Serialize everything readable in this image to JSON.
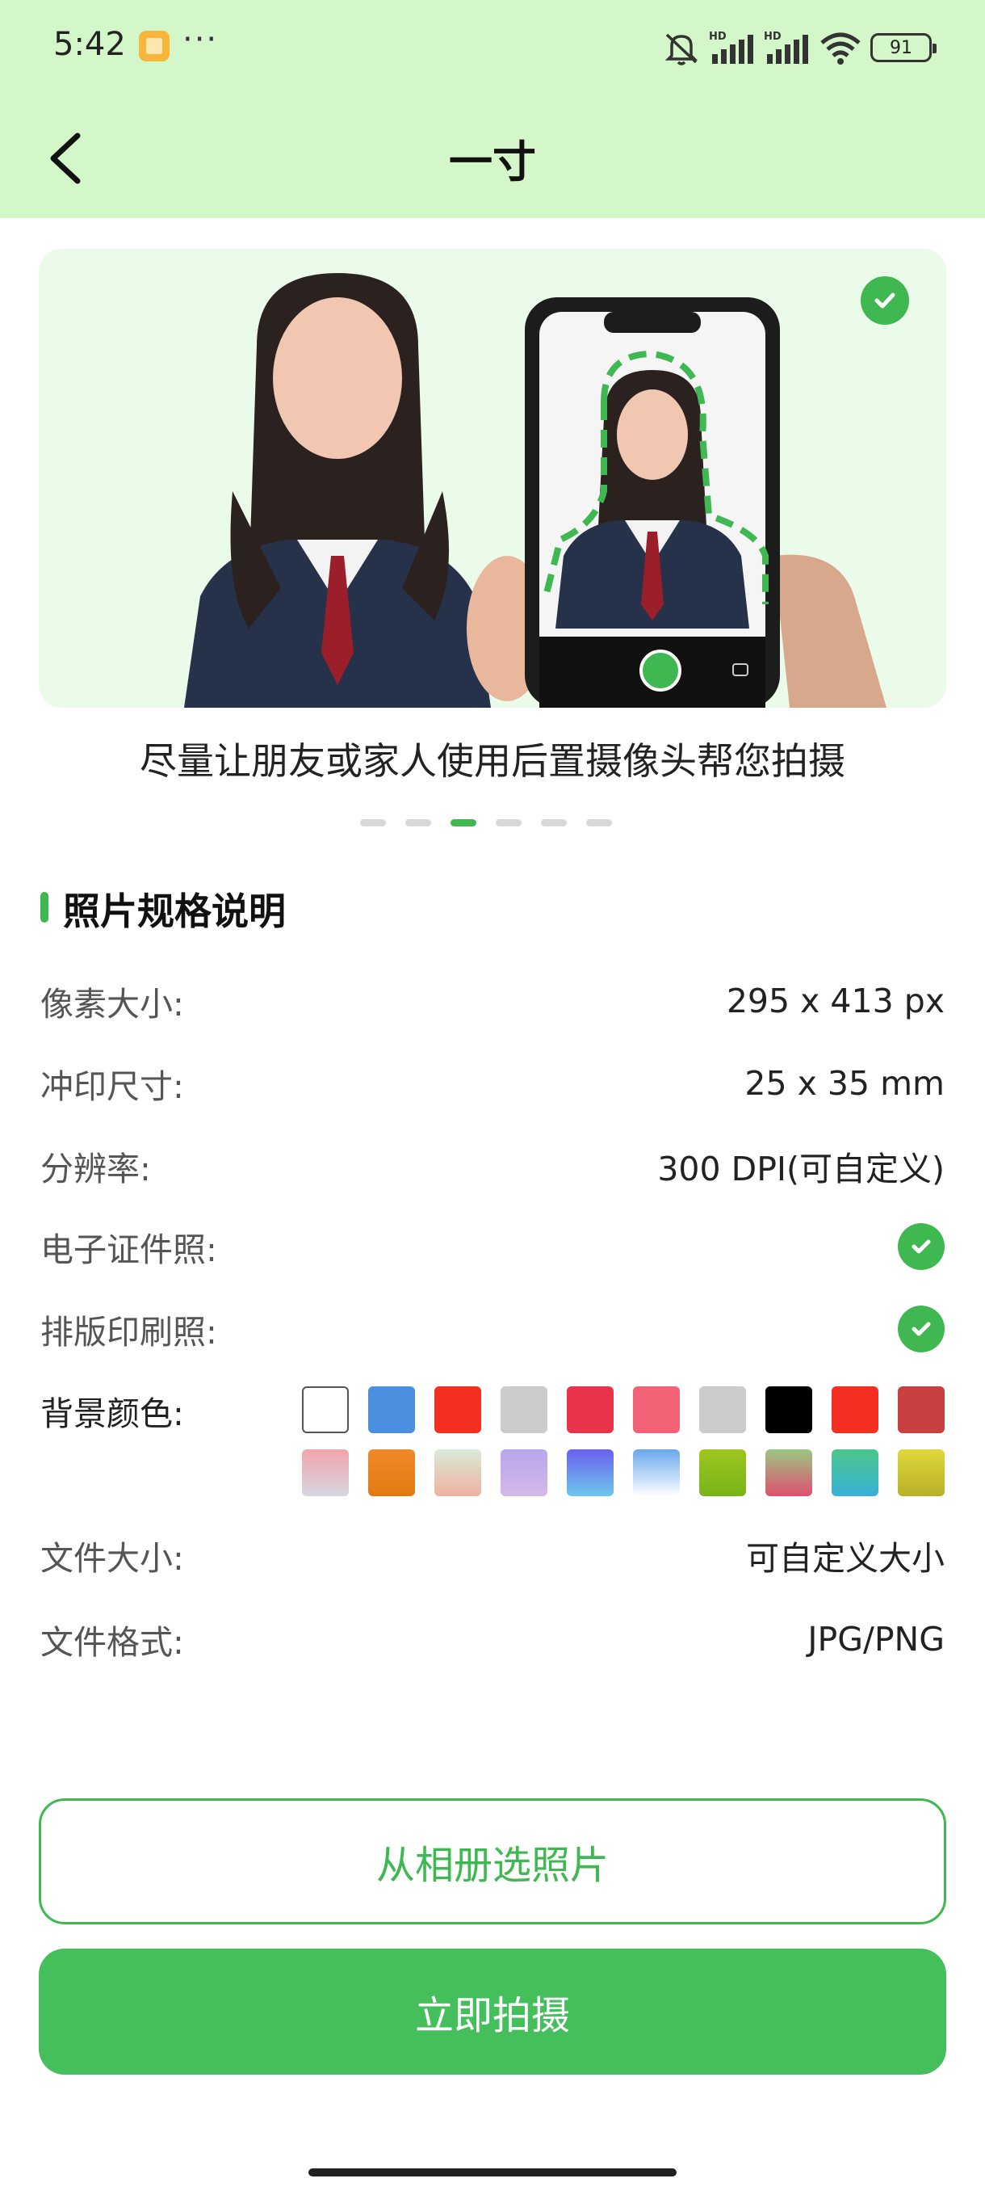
{
  "status_bar": {
    "time": "5:42",
    "dots": "···",
    "battery": "91",
    "icons": [
      "mute-icon",
      "signal-hd-icon",
      "signal-hd-icon",
      "wifi-icon",
      "battery-icon"
    ]
  },
  "header": {
    "title": "一寸",
    "back_icon": "chevron-left-icon"
  },
  "banner": {
    "caption": "尽量让朋友或家人使用后置摄像头帮您拍摄",
    "page_count": 6,
    "active_index": 2
  },
  "specs": {
    "section_title": "照片规格说明",
    "rows": [
      {
        "label": "像素大小:",
        "value": "295 x 413 px"
      },
      {
        "label": "冲印尺寸:",
        "value": "25 x 35 mm"
      },
      {
        "label": "分辨率:",
        "value": "300 DPI(可自定义)"
      },
      {
        "label": "电子证件照:",
        "value": ""
      },
      {
        "label": "排版印刷照:",
        "value": ""
      }
    ],
    "background_label": "背景颜色:",
    "file_size": {
      "label": "文件大小:",
      "value": "可自定义大小"
    },
    "file_format": {
      "label": "文件格式:",
      "value": "JPG/PNG"
    }
  },
  "colors": {
    "accent": "#3fb851",
    "header_bg": "#d3f7c8",
    "swatches": [
      "#ffffff",
      "#4a8fe0",
      "#f22f21",
      "#cccccc",
      "#e8334a",
      "#f46278",
      "#cccccc",
      "#000000",
      "#f22f21",
      "#c8403f",
      "linear-gradient(#f2a4ac,#d7d7e0)",
      "linear-gradient(#f08a2a,#e07a10)",
      "linear-gradient(#d8ecd8,#f0b0a0)",
      "linear-gradient(#b8a6ec,#d4b8e8)",
      "linear-gradient(#6a5ef0,#6ec8ec)",
      "linear-gradient(#6aa8ec,#ffffff)",
      "linear-gradient(#9ec61e,#78b418)",
      "linear-gradient(#9ac882,#e04f70)",
      "linear-gradient(#4ac88a,#3ab0d8)",
      "linear-gradient(#e0d83a,#b8b028)"
    ]
  },
  "actions": {
    "album_button": "从相册选照片",
    "shoot_button": "立即拍摄"
  }
}
